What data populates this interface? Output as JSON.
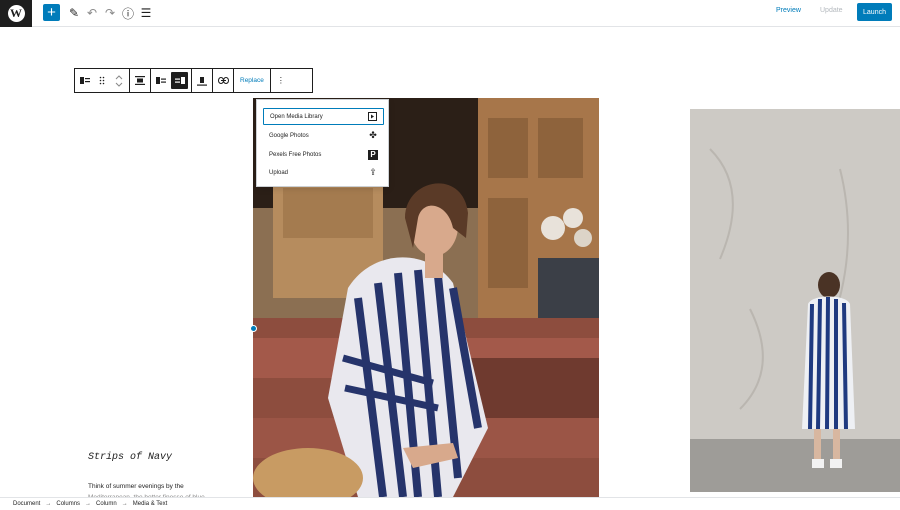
{
  "topbar": {
    "logo_letter": "W",
    "add_label": "+",
    "edit_icon": "✎",
    "undo_icon": "↶",
    "redo_icon": "↷",
    "info_icon": "ⓘ",
    "outline_icon": "☰",
    "preview_label": "Preview",
    "update_label": "Update",
    "launch_label": "Launch"
  },
  "block_toolbar": {
    "replace_label": "Replace",
    "more_icon": "⋮"
  },
  "replace_menu": {
    "items": [
      {
        "label": "Open Media Library",
        "icon": "▸"
      },
      {
        "label": "Google Photos",
        "icon": "✤"
      },
      {
        "label": "Pexels Free Photos",
        "icon": "P"
      },
      {
        "label": "Upload",
        "icon": "⇪"
      }
    ]
  },
  "content": {
    "heading": "Strips of Navy",
    "paragraph": "Think of summer evenings by the",
    "paragraph_cut": "Mediterranean, the hotter finesse of blue"
  },
  "breadcrumb": [
    "Document",
    "Columns",
    "Column",
    "Media & Text"
  ],
  "colors": {
    "accent": "#007cba",
    "dark": "#1e1e1e",
    "border": "#e2e4e7"
  }
}
